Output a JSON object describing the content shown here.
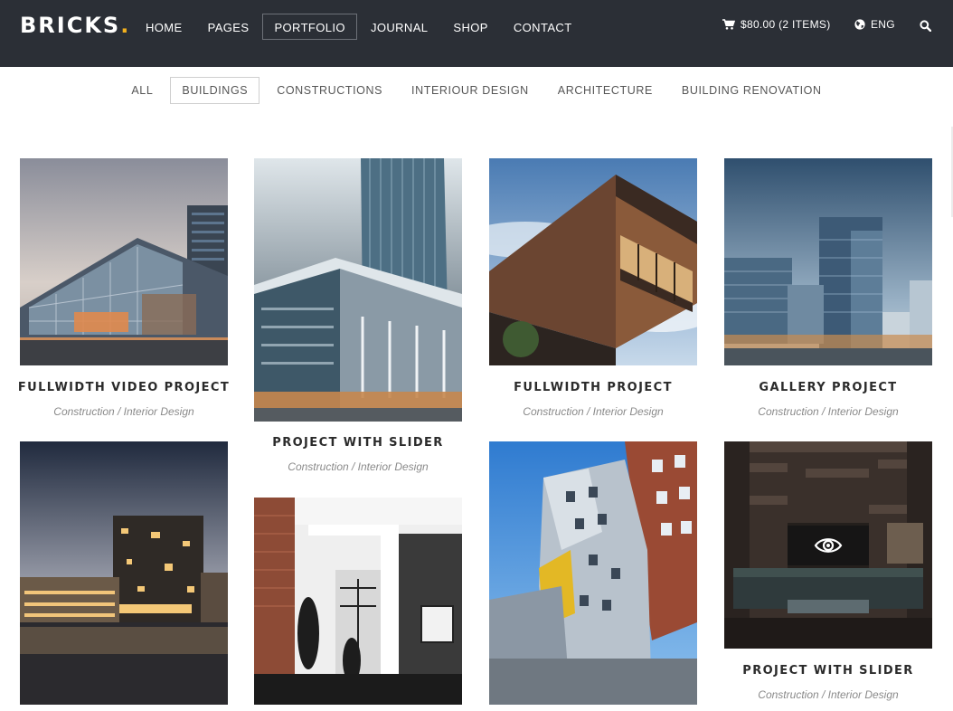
{
  "brand": {
    "name": "BRICKS",
    "dot": "."
  },
  "nav": {
    "items": [
      {
        "label": "HOME",
        "active": false
      },
      {
        "label": "PAGES",
        "active": false
      },
      {
        "label": "PORTFOLIO",
        "active": true
      },
      {
        "label": "JOURNAL",
        "active": false
      },
      {
        "label": "SHOP",
        "active": false
      },
      {
        "label": "CONTACT",
        "active": false
      }
    ],
    "cart": {
      "icon": "cart-icon",
      "label": "$80.00 (2 ITEMS)"
    },
    "language": {
      "icon": "globe-icon",
      "label": "ENG"
    },
    "search": {
      "icon": "search-icon"
    }
  },
  "filters": [
    {
      "label": "ALL",
      "active": false
    },
    {
      "label": "BUILDINGS",
      "active": true
    },
    {
      "label": "CONSTRUCTIONS",
      "active": false
    },
    {
      "label": "INTERIOUR DESIGN",
      "active": false
    },
    {
      "label": "ARCHITECTURE",
      "active": false
    },
    {
      "label": "BUILDING RENOVATION",
      "active": false
    }
  ],
  "portfolio": [
    {
      "title": "FULLWIDTH VIDEO PROJECT",
      "categories": "Construction / Interior Design"
    },
    {
      "title": "PROJECT WITH SLIDER",
      "categories": "Construction / Interior Design"
    },
    {
      "title": "FULLWIDTH PROJECT",
      "categories": "Construction / Interior Design"
    },
    {
      "title": "GALLERY PROJECT",
      "categories": "Construction / Interior Design"
    },
    {
      "title": "",
      "categories": ""
    },
    {
      "title": "",
      "categories": ""
    },
    {
      "title": "",
      "categories": ""
    },
    {
      "title": "PROJECT WITH SLIDER",
      "categories": "Construction / Interior Design",
      "overlay_icon": "eye-icon"
    }
  ],
  "colors": {
    "header_bg": "#2b2f36",
    "accent": "#f2b01e"
  }
}
